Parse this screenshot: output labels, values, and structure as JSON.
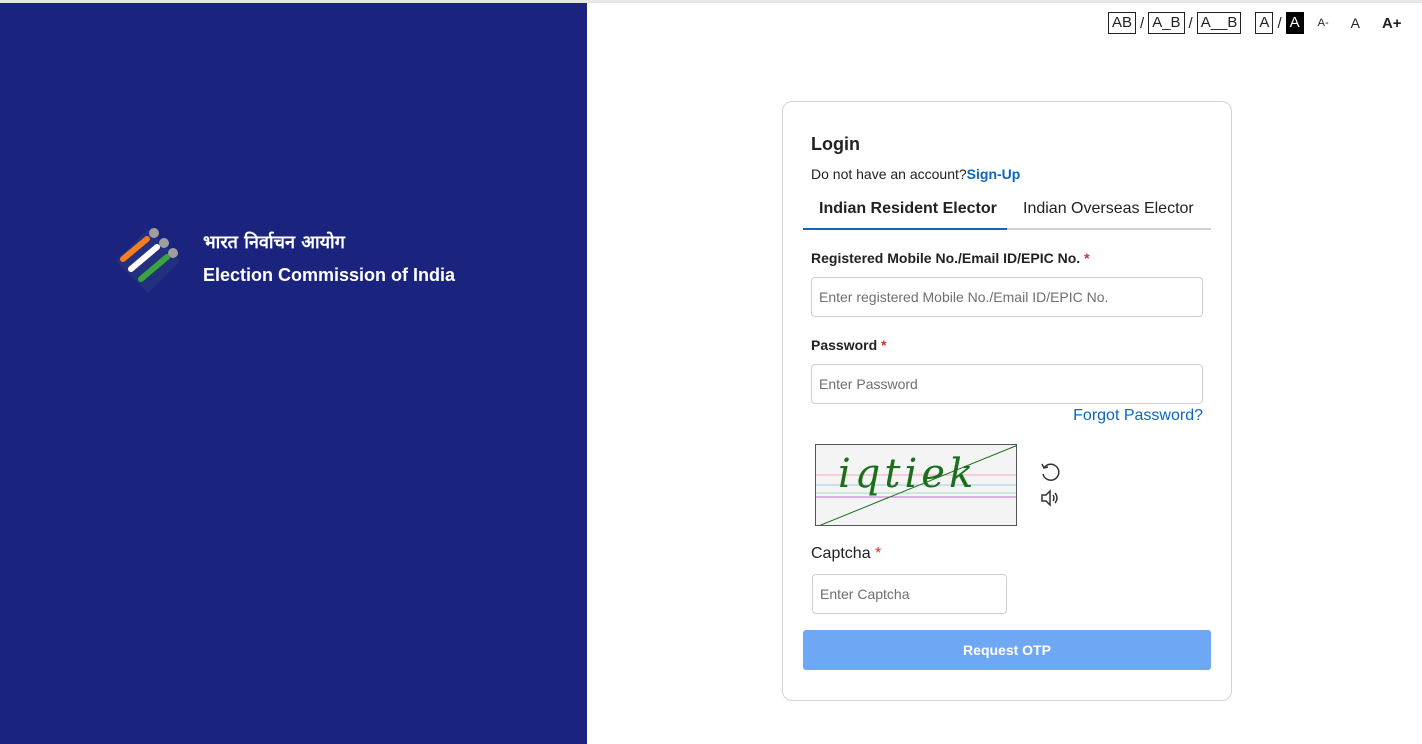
{
  "brand": {
    "hindi": "भारत निर्वाचन आयोग",
    "english": "Election Commission of India",
    "logo_colors": [
      "#f57c1f",
      "#ffffff",
      "#3aa53a",
      "#9e9e9e"
    ]
  },
  "accessibility": {
    "spacing_options": [
      "AB",
      "A_B",
      "A__B"
    ],
    "contrast_options": [
      "A",
      "A"
    ],
    "font_size_options": [
      "A-",
      "A",
      "A+"
    ],
    "separator": "/"
  },
  "login": {
    "title": "Login",
    "no_account_text": "Do not have an account?",
    "signup_label": "Sign-Up",
    "tabs": [
      {
        "label": "Indian Resident Elector",
        "active": true
      },
      {
        "label": "Indian Overseas Elector",
        "active": false
      }
    ],
    "id_field": {
      "label": "Registered Mobile No./Email ID/EPIC No.",
      "required_mark": "*",
      "placeholder": "Enter registered Mobile No./Email ID/EPIC No.",
      "value": ""
    },
    "password_field": {
      "label": "Password",
      "required_mark": "*",
      "placeholder": "Enter Password",
      "value": ""
    },
    "forgot_label": "Forgot Password?",
    "captcha": {
      "image_text": "iqtiek",
      "refresh_icon": "refresh-icon",
      "audio_icon": "speaker-icon",
      "label": "Captcha",
      "required_mark": "*",
      "placeholder": "Enter Captcha",
      "value": ""
    },
    "submit_label": "Request OTP"
  },
  "colors": {
    "left_panel": "#1a237e",
    "link": "#0a66c2",
    "button_disabled": "#6ea8f5",
    "required": "#d32f2f"
  }
}
